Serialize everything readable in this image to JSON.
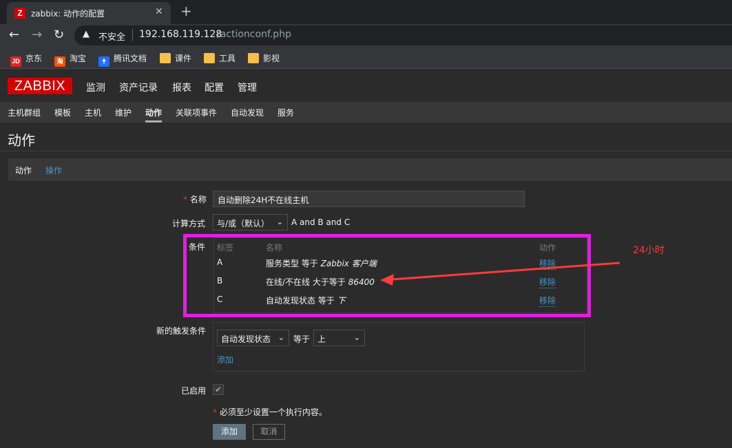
{
  "browser": {
    "tab_title": "zabbix: 动作的配置",
    "tab_favicon": "Z",
    "close_glyph": "✕",
    "new_tab_glyph": "+",
    "back_glyph": "←",
    "forward_glyph": "→",
    "reload_glyph": "↻",
    "warn_glyph": "▲",
    "insecure_label": "不安全",
    "url_host": "192.168.119.128",
    "url_path": "/actionconf.php",
    "bookmarks": [
      {
        "label": "京东",
        "icon": "JD",
        "icon_name": "jd-icon",
        "color": "#e1251b"
      },
      {
        "label": "淘宝",
        "icon": "淘",
        "icon_name": "taobao-icon",
        "color": "#ff5000"
      },
      {
        "label": "腾讯文档",
        "icon": "✝",
        "icon_name": "tencent-docs-icon",
        "color": "#1e6fff"
      },
      {
        "label": "课件",
        "icon": "",
        "icon_name": "folder-icon",
        "color": "#f5c04a"
      },
      {
        "label": "工具",
        "icon": "",
        "icon_name": "folder-icon",
        "color": "#f5c04a"
      },
      {
        "label": "影视",
        "icon": "",
        "icon_name": "folder-icon",
        "color": "#f5c04a"
      }
    ]
  },
  "zabbix": {
    "logo": "ZABBIX",
    "main_menu": [
      "监测",
      "资产记录",
      "报表",
      "配置",
      "管理"
    ],
    "sub_menu": [
      "主机群组",
      "模板",
      "主机",
      "维护",
      "动作",
      "关联项事件",
      "自动发现",
      "服务"
    ],
    "page_title": "动作"
  },
  "tabs": [
    "动作",
    "操作"
  ],
  "form": {
    "name_label": "名称",
    "required_mark": "*",
    "name_value": "自动删除24H不在线主机",
    "calc_label": "计算方式",
    "calc_value": "与/或（默认）",
    "calc_expression": "A and B and C",
    "conditions_label": "条件",
    "conditions_headers": {
      "label": "标签",
      "name": "名称",
      "action": "动作"
    },
    "conditions": [
      {
        "label": "A",
        "name_prefix": "服务类型 等于 ",
        "name_value": "Zabbix 客户端",
        "remove": "移除"
      },
      {
        "label": "B",
        "name_prefix": "在线/不在线 大于等于 ",
        "name_value": "86400",
        "remove": "移除"
      },
      {
        "label": "C",
        "name_prefix": "自动发现状态 等于 ",
        "name_value": "下",
        "remove": "移除"
      }
    ],
    "new_condition_label": "新的触发条件",
    "new_condition_type": "自动发现状态",
    "new_condition_operator": "等于",
    "new_condition_value": "上",
    "add_link": "添加",
    "enabled_label": "已启用",
    "enabled_checked": true,
    "check_glyph": "✔",
    "caret_glyph": "⌄",
    "note": "必须至少设置一个执行内容。",
    "add_button": "添加",
    "cancel_button": "取消"
  },
  "annotation": {
    "text": "24小时",
    "color": "#ff3b3b",
    "box_color": "#e020e0"
  }
}
